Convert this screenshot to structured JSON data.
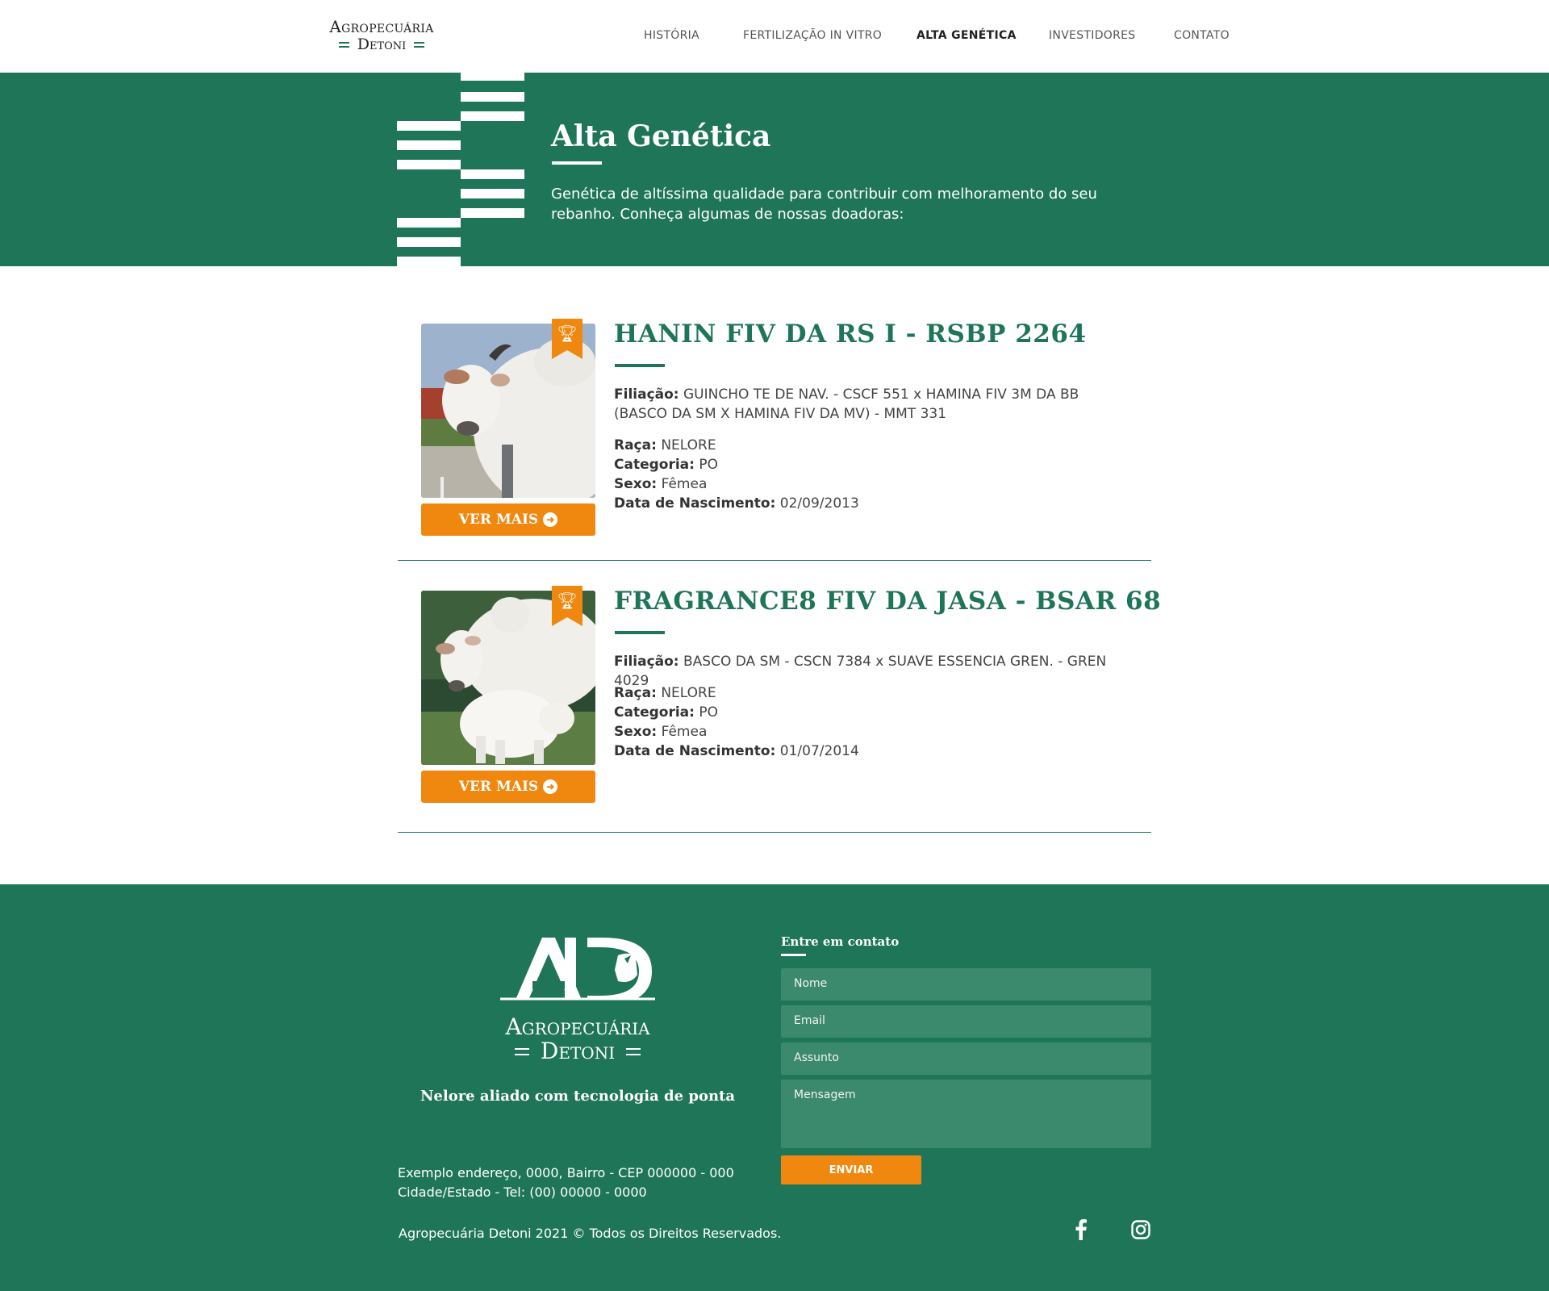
{
  "header": {
    "logo_line1": "Agropecuária",
    "logo_line2": "Detoni",
    "nav": [
      {
        "label": "HISTÓRIA"
      },
      {
        "label": "FERTILIZAÇÃO IN VITRO"
      },
      {
        "label": "ALTA GENÉTICA",
        "active": true
      },
      {
        "label": "INVESTIDORES"
      },
      {
        "label": "CONTATO"
      }
    ]
  },
  "hero": {
    "title": "Alta Genética",
    "text": "Genética de altíssima qualidade para contribuir com melhoramento do seu rebanho. Conheça algumas de nossas doadoras:"
  },
  "labels": {
    "filiacao": "Filiação:",
    "raca": "Raça:",
    "categoria": "Categoria:",
    "sexo": "Sexo:",
    "nascimento": "Data de Nascimento:",
    "ver_mais": "VER MAIS"
  },
  "animals": [
    {
      "name": "HANIN FIV DA RS I - RSBP 2264",
      "filiacao": "GUINCHO TE DE NAV. - CSCF 551 x HAMINA FIV 3M DA BB (BASCO DA SM X HAMINA FIV DA MV) - MMT 331",
      "raca": "NELORE",
      "categoria": "PO",
      "sexo": "Fêmea",
      "nascimento": "02/09/2013"
    },
    {
      "name": "FRAGRANCE8 FIV DA JASA - BSAR 68",
      "filiacao": "BASCO DA SM - CSCN 7384 x SUAVE ESSENCIA GREN. - GREN 4029",
      "raca": "NELORE",
      "categoria": "PO",
      "sexo": "Fêmea",
      "nascimento": "01/07/2014"
    }
  ],
  "footer": {
    "logo_name1": "Agropecuária",
    "logo_name2": "Detoni",
    "tagline": "Nelore aliado com tecnologia de ponta",
    "address1": "Exemplo endereço, 0000, Bairro - CEP 000000 - 000",
    "address2": "Cidade/Estado - Tel: (00) 00000 - 0000",
    "copyright": "Agropecuária Detoni 2021 © Todos os Direitos Reservados.",
    "contact_title": "Entre em contato",
    "fields": {
      "nome": "Nome",
      "email": "Email",
      "assunto": "Assunto",
      "mensagem": "Mensagem"
    },
    "send_label": "ENVIAR",
    "social": [
      "facebook-icon",
      "instagram-icon"
    ]
  },
  "colors": {
    "brand_green": "#1f7558",
    "accent_orange": "#f0870f",
    "field_green": "#3b8a6e"
  }
}
